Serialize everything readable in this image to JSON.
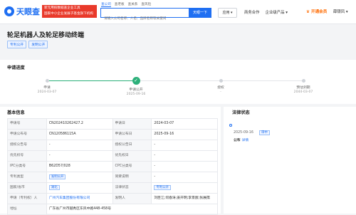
{
  "header": {
    "logo_text": "天眼查",
    "promo_line1": "新元用统数据查企业工具",
    "promo_line2": "国家中小企业发展子基金旗下机构",
    "search_tabs": [
      "查公司",
      "查老板",
      "查关系",
      "查风险"
    ],
    "search_placeholder": "请输入公司名称、人名、品牌名称等关键词",
    "search_button": "天眼一下",
    "app_button": "应用",
    "nav": [
      "商务合作",
      "企业级产品"
    ],
    "vip_label": "开通会员",
    "user_label": "薛银凤"
  },
  "patent": {
    "title": "轮足机器人及轮足移动终端",
    "tags": [
      "专利公开",
      "发明公开"
    ]
  },
  "progress": {
    "title": "申请进度",
    "steps": [
      {
        "label": "申请",
        "date": "2024-03-07"
      },
      {
        "label": "申请公开",
        "date": "2025-09-16"
      },
      {
        "label": "授权",
        "date": "-"
      },
      {
        "label": "预估到期",
        "date": "2044-03-07"
      }
    ]
  },
  "info": {
    "title": "基本信息",
    "rows": [
      {
        "k1": "申请号",
        "v1": "CN202410262427.2",
        "k2": "申请日",
        "v2": "2024-03-07"
      },
      {
        "k1": "申请公布号",
        "v1": "CN120586115A",
        "k2": "申请公布日",
        "v2": "2025-09-16"
      },
      {
        "k1": "授权公告号",
        "v1": "-",
        "k2": "授权公告日",
        "v2": "-"
      },
      {
        "k1": "优先权号",
        "v1": "-",
        "k2": "优先权日",
        "v2": "-"
      },
      {
        "k1": "IPC分类号",
        "v1": "B62D57/028",
        "k2": "CPC分类号",
        "v2": "-"
      },
      {
        "k1": "专利类型",
        "v1": "发明公开",
        "k2": "简要说明",
        "v2": "-"
      },
      {
        "k1": "国家/省市",
        "v1": "湖北",
        "k2": "法律状态",
        "v2": "专利公开"
      },
      {
        "k1": "申请（专利权）人",
        "v1": "广州汽车集团股份有限公司",
        "k2": "发明人",
        "v2": "刘臣江;何春涛;姜开明;李景宸;张展孺"
      },
      {
        "k1": "地址",
        "v": "广东省广州市越秀区东风中路448-458号"
      }
    ]
  },
  "legal": {
    "title": "法律状态",
    "date": "2025-09-16",
    "status": "审中",
    "event": "公布",
    "detail": "详情"
  }
}
